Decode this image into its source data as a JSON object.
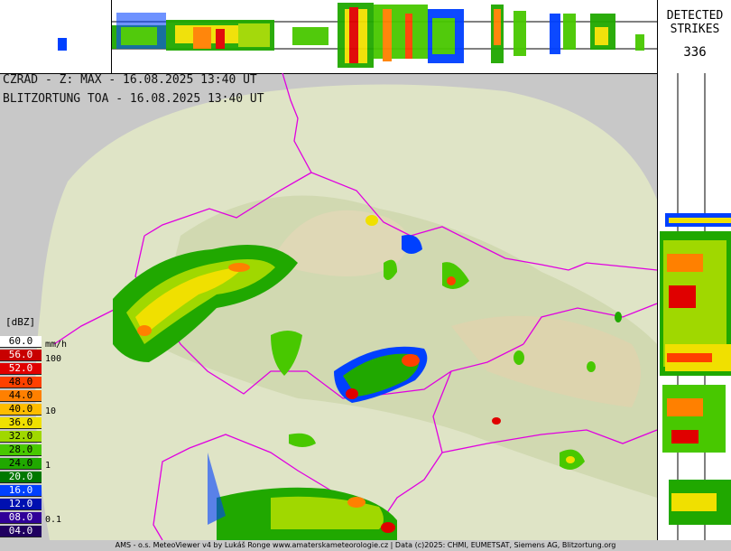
{
  "header": {
    "line1": "CZRAD - Z: MAX - 16.08.2025 13:40 UT",
    "line2": "BLITZORTUNG TOA - 16.08.2025 13:40 UT"
  },
  "strikes": {
    "label_line1": "DETECTED",
    "label_line2": "STRIKES",
    "count": "336"
  },
  "legend": {
    "unit": "[dBZ]",
    "rate_unit": "mm/h",
    "rows": [
      {
        "label": "60.0",
        "color": "#ffffff",
        "text": "#000000"
      },
      {
        "label": "56.0",
        "color": "#c80000",
        "text": "#ffffff"
      },
      {
        "label": "52.0",
        "color": "#e00000",
        "text": "#ffffff"
      },
      {
        "label": "48.0",
        "color": "#ff4000",
        "text": "#000000"
      },
      {
        "label": "44.0",
        "color": "#ff8000",
        "text": "#000000"
      },
      {
        "label": "40.0",
        "color": "#ffbc00",
        "text": "#000000"
      },
      {
        "label": "36.0",
        "color": "#f0e000",
        "text": "#000000"
      },
      {
        "label": "32.0",
        "color": "#a0d800",
        "text": "#000000"
      },
      {
        "label": "28.0",
        "color": "#48c800",
        "text": "#000000"
      },
      {
        "label": "24.0",
        "color": "#20a800",
        "text": "#000000"
      },
      {
        "label": "20.0",
        "color": "#007800",
        "text": "#ffffff"
      },
      {
        "label": "16.0",
        "color": "#0040ff",
        "text": "#ffffff"
      },
      {
        "label": "12.0",
        "color": "#0010b0",
        "text": "#ffffff"
      },
      {
        "label": "08.0",
        "color": "#300098",
        "text": "#ffffff"
      },
      {
        "label": "04.0",
        "color": "#200060",
        "text": "#ffffff"
      }
    ],
    "rates": [
      "100",
      "10",
      "1",
      "0.1"
    ]
  },
  "footer": "AMS - o.s. MeteoViewer v4 by Lukáš Ronge www.amaterskameteorologie.cz | Data (c)2025: CHMI, EUMETSAT, Siemens AG, Blitzortung.org",
  "colors": {
    "border": "#e000e0",
    "terrain": "#dfe4c6",
    "outside": "#c8c8c8"
  }
}
